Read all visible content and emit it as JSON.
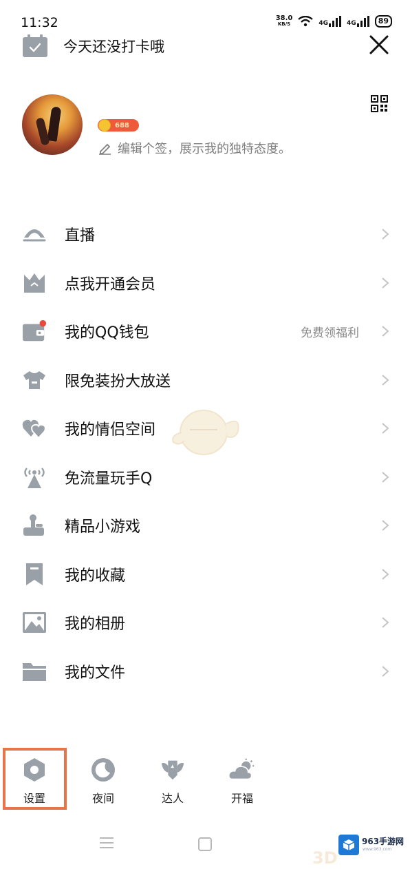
{
  "status_bar": {
    "time": "11:32",
    "net_speed": "38.0",
    "net_unit": "KB/S",
    "signal1": "4G",
    "signal2": "4G",
    "battery": "89"
  },
  "header": {
    "checkin_text": "今天还没打卡哦"
  },
  "profile": {
    "level_badge": "688",
    "signature": "编辑个签，展示我的独特态度。"
  },
  "menu": {
    "items": [
      {
        "label": "直播",
        "icon": "live-icon"
      },
      {
        "label": "点我开通会员",
        "icon": "crown-bag-icon"
      },
      {
        "label": "我的QQ钱包",
        "icon": "wallet-icon",
        "extra": "免费领福利"
      },
      {
        "label": "限免装扮大放送",
        "icon": "shirt-icon"
      },
      {
        "label": "我的情侣空间",
        "icon": "hearts-icon"
      },
      {
        "label": "免流量玩手Q",
        "icon": "signal-tower-icon"
      },
      {
        "label": "精品小游戏",
        "icon": "joystick-icon"
      },
      {
        "label": "我的收藏",
        "icon": "bookmark-icon"
      },
      {
        "label": "我的相册",
        "icon": "photo-icon"
      },
      {
        "label": "我的文件",
        "icon": "folder-icon"
      }
    ]
  },
  "quick_actions": {
    "settings": "设置",
    "night": "夜间",
    "expert": "达人",
    "blessing": "开福"
  },
  "watermark": {
    "brand": "963手游网",
    "sub": "www.963.com",
    "mark": "3D"
  },
  "colors": {
    "icon_gray": "#8e9399",
    "highlight": "#e8744a",
    "badge": "#ee5a3a",
    "notify_dot": "#e84b3c"
  }
}
